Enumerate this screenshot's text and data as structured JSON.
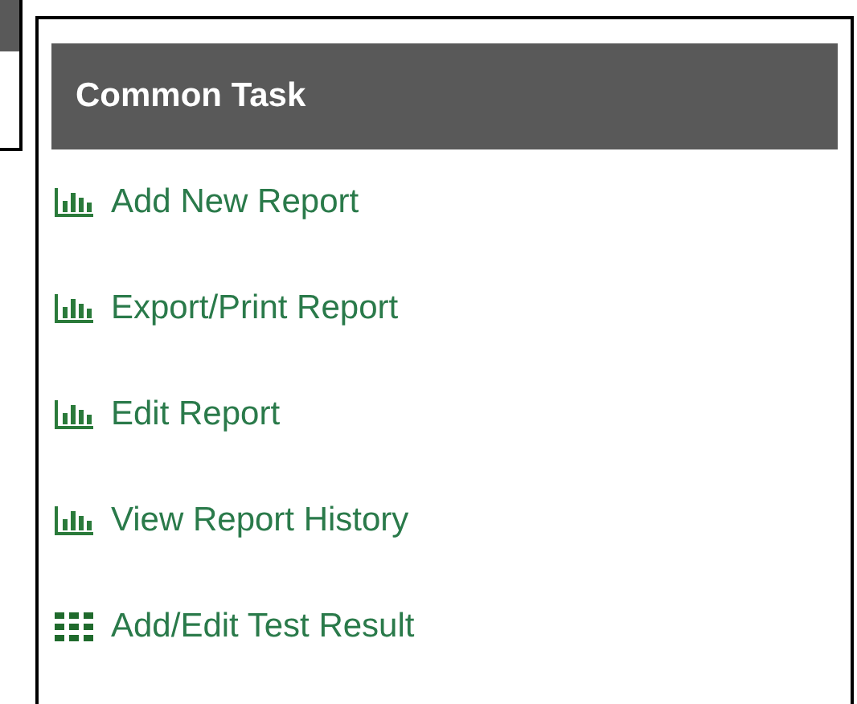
{
  "panel": {
    "title": "Common Task",
    "items": [
      {
        "label": "Add New Report",
        "kind": "chart"
      },
      {
        "label": "Export/Print Report",
        "kind": "chart"
      },
      {
        "label": "Edit Report",
        "kind": "chart"
      },
      {
        "label": "View Report History",
        "kind": "chart"
      },
      {
        "label": "Add/Edit Test Result",
        "kind": "grid"
      }
    ]
  }
}
